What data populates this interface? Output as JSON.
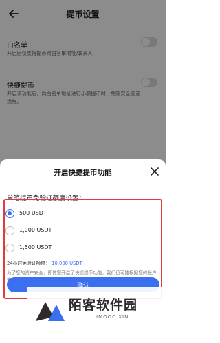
{
  "header": {
    "title": "提币设置"
  },
  "settings": [
    {
      "label": "白名单",
      "desc": "开启后仅支持提币到白名单地址/联系人"
    },
    {
      "label": "快捷提币",
      "desc": "开启该功能后，向白名单地址进行小额提币时，免除安全验证流程。"
    }
  ],
  "sheet": {
    "title": "开启快捷提币功能",
    "section_label": "单笔提币免验证额度设置：",
    "options": [
      {
        "label": "500 USDT",
        "checked": true
      },
      {
        "label": "1,000 USDT",
        "checked": false
      },
      {
        "label": "1,500 USDT",
        "checked": false
      }
    ],
    "limit_prefix": "24小时免验证额度：",
    "limit_value": "10,000 USDT",
    "notice": "为了您的资产安全，即使您开启了快捷提币功能，我们仍可能根据您的账户安全情况要求您进行安全验证。",
    "confirm_label": "确认"
  },
  "watermark": {
    "text": "陌客软件园",
    "sub": "IMOOC XIN"
  },
  "colors": {
    "accent": "#3a6ff0",
    "highlight_frame": "#e43a3a"
  }
}
